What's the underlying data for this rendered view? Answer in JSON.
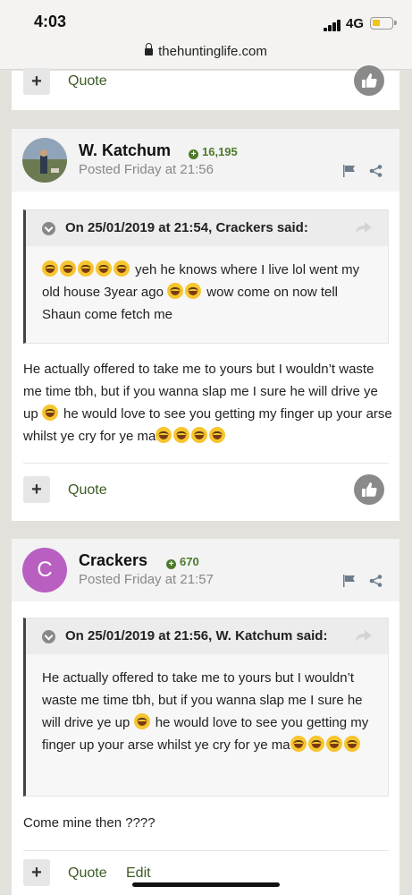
{
  "status": {
    "time": "4:03",
    "network": "4G"
  },
  "browser": {
    "url": "thehuntinglife.com"
  },
  "top_card": {
    "quote_label": "Quote"
  },
  "post1": {
    "username": "W. Katchum",
    "reputation": "16,195",
    "posted": "Posted Friday at 21:56",
    "quote_title": "On 25/01/2019 at 21:54, Crackers said:",
    "quote_text": "yeh he knows where I live lol went my old house 3year ago",
    "quote_text2": "wow come on now tell Shaun come fetch me",
    "body": "He actually offered to take me to yours but I wouldn’t waste me time tbh, but if you wanna slap me I sure he will drive ye up",
    "body2": "he would love to see you getting my finger up your arse whilst ye cry for ye ma",
    "quote_label": "Quote"
  },
  "post2": {
    "avatar_letter": "C",
    "avatar_color": "#b85fc1",
    "username": "Crackers",
    "reputation": "670",
    "posted": "Posted Friday at 21:57",
    "quote_title": "On 25/01/2019 at 21:56, W. Katchum said:",
    "quote_text": "He actually offered to take me to yours but I wouldn’t waste me time tbh, but if you wanna slap me I sure he will drive ye up",
    "quote_text2": "he would love to see you getting my finger up your arse whilst ye cry for ye ma",
    "body": "Come mine then ????",
    "quote_label": "Quote",
    "edit_label": "Edit"
  },
  "colors": {
    "link": "#3d5b22",
    "reputation": "#4d7a2c"
  },
  "icons": [
    "lock-icon",
    "plus-icon",
    "thumbs-up-icon",
    "flag-icon",
    "share-icon",
    "chevron-down-icon",
    "reply-arrow-icon",
    "emoji-icon"
  ]
}
